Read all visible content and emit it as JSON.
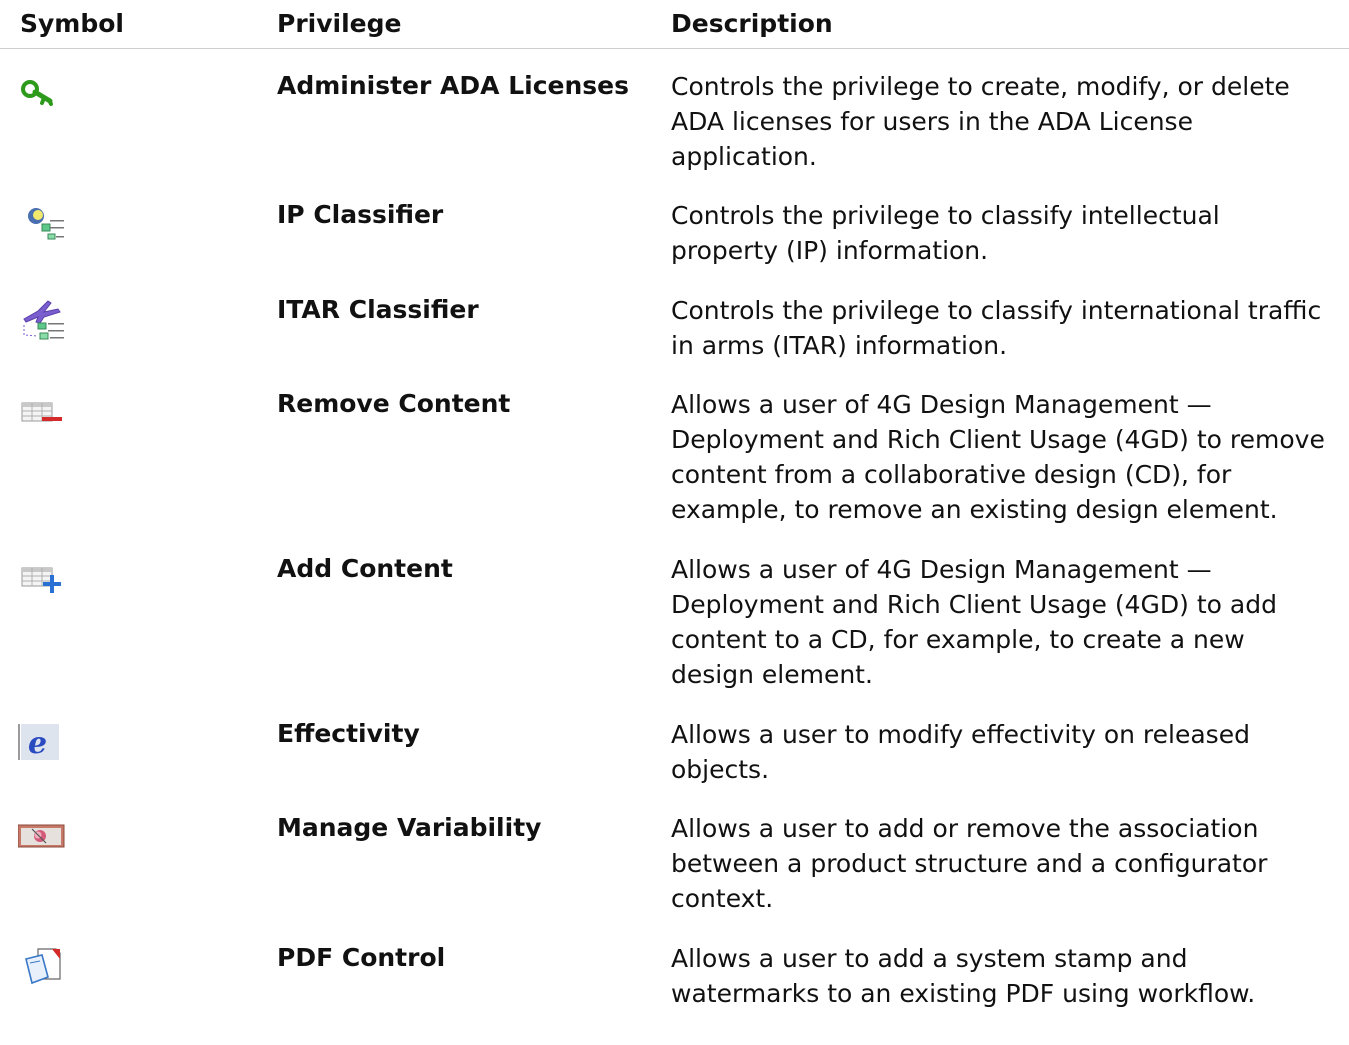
{
  "header": {
    "symbol": "Symbol",
    "privilege": "Privilege",
    "description": "Description"
  },
  "rows": [
    {
      "icon": "green-key-icon",
      "privilege": "Administer ADA Licenses",
      "description_lines": [
        "Controls the privilege to create, modify, or delete",
        "ADA licenses for users in the ADA License",
        "application."
      ]
    },
    {
      "icon": "ip-classifier-icon",
      "privilege": "IP Classifier",
      "description_lines": [
        "Controls the privilege to classify intellectual",
        "property (IP) information."
      ]
    },
    {
      "icon": "itar-classifier-icon",
      "privilege": "ITAR Classifier",
      "description_lines": [
        "Controls the privilege to classify international traffic",
        "in arms (ITAR) information."
      ]
    },
    {
      "icon": "remove-content-icon",
      "privilege": "Remove Content",
      "description_lines": [
        "Allows a user of 4G Design Management —",
        "Deployment and Rich Client Usage (4GD) to remove",
        "content from a collaborative design (CD), for",
        "example, to remove an existing design element."
      ]
    },
    {
      "icon": "add-content-icon",
      "privilege": "Add Content",
      "description_lines": [
        "Allows a user of 4G Design Management —",
        "Deployment and Rich Client Usage (4GD) to add",
        "content to a CD, for example, to create a new",
        "design element."
      ]
    },
    {
      "icon": "effectivity-icon",
      "privilege": "Effectivity",
      "description_lines": [
        "Allows a user to modify effectivity on released",
        "objects."
      ]
    },
    {
      "icon": "manage-variability-icon",
      "privilege": "Manage Variability",
      "description_lines": [
        "Allows a user to add or remove the association",
        "between a product structure and a configurator",
        "context."
      ]
    },
    {
      "icon": "pdf-control-icon",
      "privilege": "PDF Control",
      "description_lines": [
        "Allows a user to add a system stamp and",
        "watermarks to an existing PDF using workflow."
      ]
    }
  ]
}
